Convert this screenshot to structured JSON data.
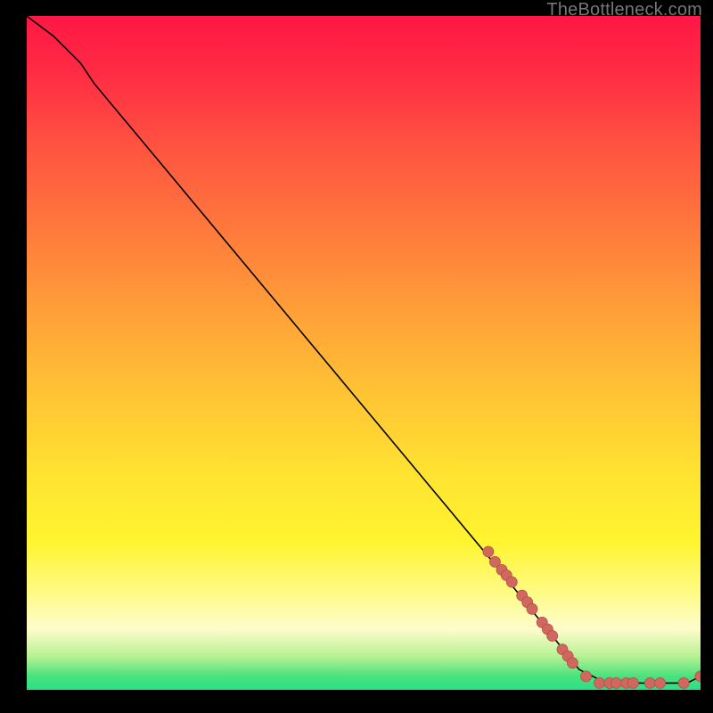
{
  "watermark": "TheBottleneck.com",
  "colors": {
    "point_fill": "#d0685f",
    "point_stroke": "#b24f47",
    "curve_stroke": "#000000"
  },
  "chart_data": {
    "type": "line",
    "title": "",
    "xlabel": "",
    "ylabel": "",
    "xlim": [
      0,
      100
    ],
    "ylim": [
      0,
      100
    ],
    "curve": [
      {
        "x": 0,
        "y": 100
      },
      {
        "x": 4,
        "y": 97
      },
      {
        "x": 8,
        "y": 93
      },
      {
        "x": 10,
        "y": 90
      },
      {
        "x": 20,
        "y": 78
      },
      {
        "x": 30,
        "y": 66
      },
      {
        "x": 40,
        "y": 54
      },
      {
        "x": 50,
        "y": 42
      },
      {
        "x": 60,
        "y": 30
      },
      {
        "x": 70,
        "y": 18
      },
      {
        "x": 78,
        "y": 8
      },
      {
        "x": 82,
        "y": 3
      },
      {
        "x": 86,
        "y": 1
      },
      {
        "x": 90,
        "y": 1
      },
      {
        "x": 94,
        "y": 1
      },
      {
        "x": 98,
        "y": 1
      },
      {
        "x": 100,
        "y": 2
      }
    ],
    "points": [
      {
        "x": 68.5,
        "y": 20.5
      },
      {
        "x": 69.5,
        "y": 19.0
      },
      {
        "x": 70.5,
        "y": 17.8
      },
      {
        "x": 71.2,
        "y": 17.0
      },
      {
        "x": 72.0,
        "y": 16.0
      },
      {
        "x": 73.5,
        "y": 14.0
      },
      {
        "x": 74.3,
        "y": 13.0
      },
      {
        "x": 75.0,
        "y": 12.0
      },
      {
        "x": 76.5,
        "y": 10.0
      },
      {
        "x": 77.3,
        "y": 9.0
      },
      {
        "x": 78.0,
        "y": 8.0
      },
      {
        "x": 79.5,
        "y": 6.0
      },
      {
        "x": 80.3,
        "y": 5.0
      },
      {
        "x": 81.0,
        "y": 4.0
      },
      {
        "x": 83.0,
        "y": 2.0
      },
      {
        "x": 85.0,
        "y": 1.0
      },
      {
        "x": 86.5,
        "y": 1.0
      },
      {
        "x": 87.5,
        "y": 1.0
      },
      {
        "x": 89.0,
        "y": 1.0
      },
      {
        "x": 90.0,
        "y": 1.0
      },
      {
        "x": 92.5,
        "y": 1.0
      },
      {
        "x": 94.0,
        "y": 1.0
      },
      {
        "x": 97.5,
        "y": 1.0
      },
      {
        "x": 100.0,
        "y": 2.0
      }
    ]
  }
}
